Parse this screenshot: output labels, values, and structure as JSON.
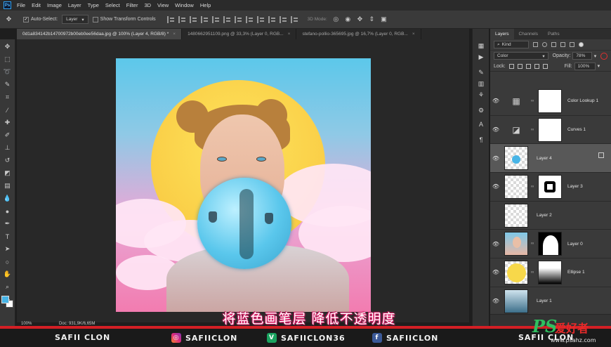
{
  "app": {
    "logo_text": "Ps"
  },
  "menu": [
    "File",
    "Edit",
    "Image",
    "Layer",
    "Type",
    "Select",
    "Filter",
    "3D",
    "View",
    "Window",
    "Help"
  ],
  "options_bar": {
    "auto_select_label": "Auto-Select:",
    "auto_select_value": "Layer",
    "transform_label": "Show Transform Controls",
    "mode_label": "3D Mode:"
  },
  "doc_tabs": [
    {
      "label": "0d1a834142b14700972b00eb0ee56daa.jpg @ 100% (Layer 4, RGB/8) *",
      "active": true
    },
    {
      "label": "1480662951109.png @ 33,3% (Layer 0, RGB...",
      "active": false
    },
    {
      "label": "stefano-pollio-365695.jpg @ 16,7% (Layer 0, RGB...",
      "active": false
    }
  ],
  "tools": [
    "move-icon",
    "marquee-icon",
    "lasso-icon",
    "quick-select-icon",
    "crop-icon",
    "eyedropper-icon",
    "healing-icon",
    "brush-icon",
    "stamp-icon",
    "history-brush-icon",
    "eraser-icon",
    "gradient-icon",
    "blur-icon",
    "dodge-icon",
    "pen-icon",
    "type-icon",
    "path-select-icon",
    "shape-icon",
    "hand-icon",
    "zoom-icon"
  ],
  "colors": {
    "foreground": "#47b4e6",
    "background": "#ffffff"
  },
  "status": {
    "zoom": "100%",
    "doc": "Doc: 931,9K/6,65M"
  },
  "layers_panel": {
    "tabs": [
      {
        "label": "Layers",
        "active": true
      },
      {
        "label": "Channels",
        "active": false
      },
      {
        "label": "Paths",
        "active": false
      }
    ],
    "filter_kind": "Kind",
    "blend_mode": "Color",
    "opacity_label": "Opacity:",
    "opacity_value": "78%",
    "lock_label": "Lock:",
    "fill_label": "Fill:",
    "fill_value": "100%",
    "layers": [
      {
        "name": "Color Lookup 1",
        "type": "adjustment",
        "icon": "color-lookup-icon",
        "mask": "white",
        "selected": false
      },
      {
        "name": "Curves 1",
        "type": "adjustment",
        "icon": "curves-icon",
        "mask": "white",
        "selected": false
      },
      {
        "name": "Layer 4",
        "type": "pixel",
        "thumb": "blue-dot",
        "selected": true
      },
      {
        "name": "Layer 3",
        "type": "pixel",
        "thumb": "transparent",
        "mask": "frame",
        "selected": false
      },
      {
        "name": "Layer 2",
        "type": "pixel",
        "thumb": "transparent",
        "selected": false
      },
      {
        "name": "Layer 0",
        "type": "pixel",
        "thumb": "portrait",
        "mask": "silhouette",
        "selected": false
      },
      {
        "name": "Ellipse 1",
        "type": "shape",
        "thumb": "yellow-circle",
        "mask": "gradient",
        "selected": false
      },
      {
        "name": "Layer 1",
        "type": "pixel",
        "thumb": "sky",
        "selected": false
      }
    ]
  },
  "subtitle": "将蓝色画笔层 降低不透明度",
  "banner": {
    "name": "SAFII CLON",
    "instagram": "SAFIICLON",
    "vine": "SAFIICLON36",
    "facebook": "SAFIICLON",
    "last": "SAFII CLON"
  },
  "watermark": {
    "ps": "PS",
    "cn": "爱好者",
    "url": "www.psahz.com"
  }
}
